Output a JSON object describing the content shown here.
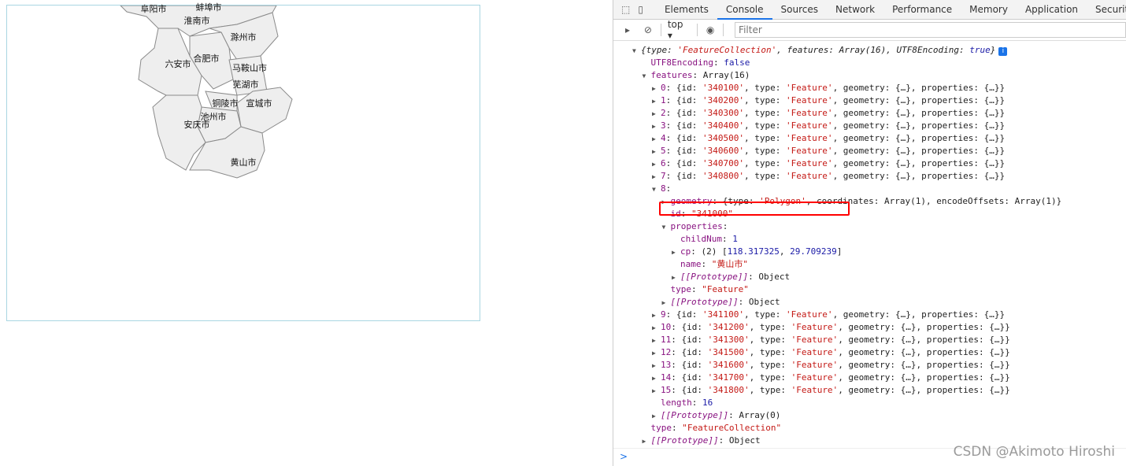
{
  "map": {
    "labels": [
      "阜阳市",
      "蚌埠市",
      "淮南市",
      "滁州市",
      "合肥市",
      "六安市",
      "马鞍山市",
      "芜湖市",
      "铜陵市",
      "宣城市",
      "池州市",
      "安庆市",
      "黄山市"
    ],
    "border_color": "#a9d6e2",
    "fill": "#eeeeee"
  },
  "devtools": {
    "tabs": [
      "Elements",
      "Console",
      "Sources",
      "Network",
      "Performance",
      "Memory",
      "Application",
      "Security"
    ],
    "active_tab": "Console",
    "context": "top",
    "filter_placeholder": "Filter",
    "prompt": ">",
    "lines": [
      {
        "d": 0,
        "a": "▼",
        "seg": [
          [
            "p i",
            "{type: "
          ],
          [
            "s i",
            "'FeatureCollection'"
          ],
          [
            "p i",
            ", features: Array(16), UTF8Encoding: "
          ],
          [
            "n i",
            "true"
          ],
          [
            "p i",
            "}"
          ]
        ],
        "info": "i"
      },
      {
        "d": 1,
        "seg": [
          [
            "k",
            "UTF8Encoding"
          ],
          [
            "p",
            ": "
          ],
          [
            "n",
            "false"
          ]
        ]
      },
      {
        "d": 1,
        "a": "▼",
        "seg": [
          [
            "k",
            "features"
          ],
          [
            "p",
            ": Array(16)"
          ]
        ]
      },
      {
        "d": 2,
        "a": "▶",
        "feat": [
          "0",
          "340100"
        ]
      },
      {
        "d": 2,
        "a": "▶",
        "feat": [
          "1",
          "340200"
        ]
      },
      {
        "d": 2,
        "a": "▶",
        "feat": [
          "2",
          "340300"
        ]
      },
      {
        "d": 2,
        "a": "▶",
        "feat": [
          "3",
          "340400"
        ]
      },
      {
        "d": 2,
        "a": "▶",
        "feat": [
          "4",
          "340500"
        ]
      },
      {
        "d": 2,
        "a": "▶",
        "feat": [
          "5",
          "340600"
        ]
      },
      {
        "d": 2,
        "a": "▶",
        "feat": [
          "6",
          "340700"
        ]
      },
      {
        "d": 2,
        "a": "▶",
        "feat": [
          "7",
          "340800"
        ]
      },
      {
        "d": 2,
        "a": "▼",
        "seg": [
          [
            "k",
            "8"
          ],
          [
            "p",
            ":"
          ]
        ]
      },
      {
        "d": 3,
        "a": "▶",
        "seg": [
          [
            "k",
            "geometry"
          ],
          [
            "p",
            ": {type: "
          ],
          [
            "s",
            "'Polygon'"
          ],
          [
            "p",
            ", coordinates: Array(1), encodeOffsets: Array(1)}"
          ]
        ]
      },
      {
        "d": 3,
        "seg": [
          [
            "k",
            "id"
          ],
          [
            "p",
            ": "
          ],
          [
            "s",
            "\"341000\""
          ]
        ]
      },
      {
        "d": 3,
        "a": "▼",
        "seg": [
          [
            "k",
            "properties"
          ],
          [
            "p",
            ":"
          ]
        ]
      },
      {
        "d": 4,
        "seg": [
          [
            "k",
            "childNum"
          ],
          [
            "p",
            ": "
          ],
          [
            "n",
            "1"
          ]
        ]
      },
      {
        "d": 4,
        "a": "▶",
        "seg": [
          [
            "k",
            "cp"
          ],
          [
            "p",
            ": (2) ["
          ],
          [
            "n",
            "118.317325"
          ],
          [
            "p",
            ", "
          ],
          [
            "n",
            "29.709239"
          ],
          [
            "p",
            "]"
          ]
        ]
      },
      {
        "d": 4,
        "seg": [
          [
            "k",
            "name"
          ],
          [
            "p",
            ": "
          ],
          [
            "s",
            "\"黄山市\""
          ]
        ]
      },
      {
        "d": 4,
        "a": "▶",
        "seg": [
          [
            "k i",
            "[[Prototype]]"
          ],
          [
            "p",
            ": Object"
          ]
        ]
      },
      {
        "d": 3,
        "seg": [
          [
            "k",
            "type"
          ],
          [
            "p",
            ": "
          ],
          [
            "s",
            "\"Feature\""
          ]
        ]
      },
      {
        "d": 3,
        "a": "▶",
        "seg": [
          [
            "k i",
            "[[Prototype]]"
          ],
          [
            "p",
            ": Object"
          ]
        ]
      },
      {
        "d": 2,
        "a": "▶",
        "feat": [
          "9",
          "341100"
        ]
      },
      {
        "d": 2,
        "a": "▶",
        "feat": [
          "10",
          "341200"
        ]
      },
      {
        "d": 2,
        "a": "▶",
        "feat": [
          "11",
          "341300"
        ]
      },
      {
        "d": 2,
        "a": "▶",
        "feat": [
          "12",
          "341500"
        ]
      },
      {
        "d": 2,
        "a": "▶",
        "feat": [
          "13",
          "341600"
        ]
      },
      {
        "d": 2,
        "a": "▶",
        "feat": [
          "14",
          "341700"
        ]
      },
      {
        "d": 2,
        "a": "▶",
        "feat": [
          "15",
          "341800"
        ]
      },
      {
        "d": 2,
        "seg": [
          [
            "k",
            "length"
          ],
          [
            "p",
            ": "
          ],
          [
            "n",
            "16"
          ]
        ]
      },
      {
        "d": 2,
        "a": "▶",
        "seg": [
          [
            "k i",
            "[[Prototype]]"
          ],
          [
            "p",
            ": Array(0)"
          ]
        ]
      },
      {
        "d": 1,
        "seg": [
          [
            "k",
            "type"
          ],
          [
            "p",
            ": "
          ],
          [
            "s",
            "\"FeatureCollection\""
          ]
        ]
      },
      {
        "d": 1,
        "a": "▶",
        "seg": [
          [
            "k i",
            "[[Prototype]]"
          ],
          [
            "p",
            ": Object"
          ]
        ]
      }
    ]
  },
  "watermark": "CSDN @Akimoto Hiroshi"
}
